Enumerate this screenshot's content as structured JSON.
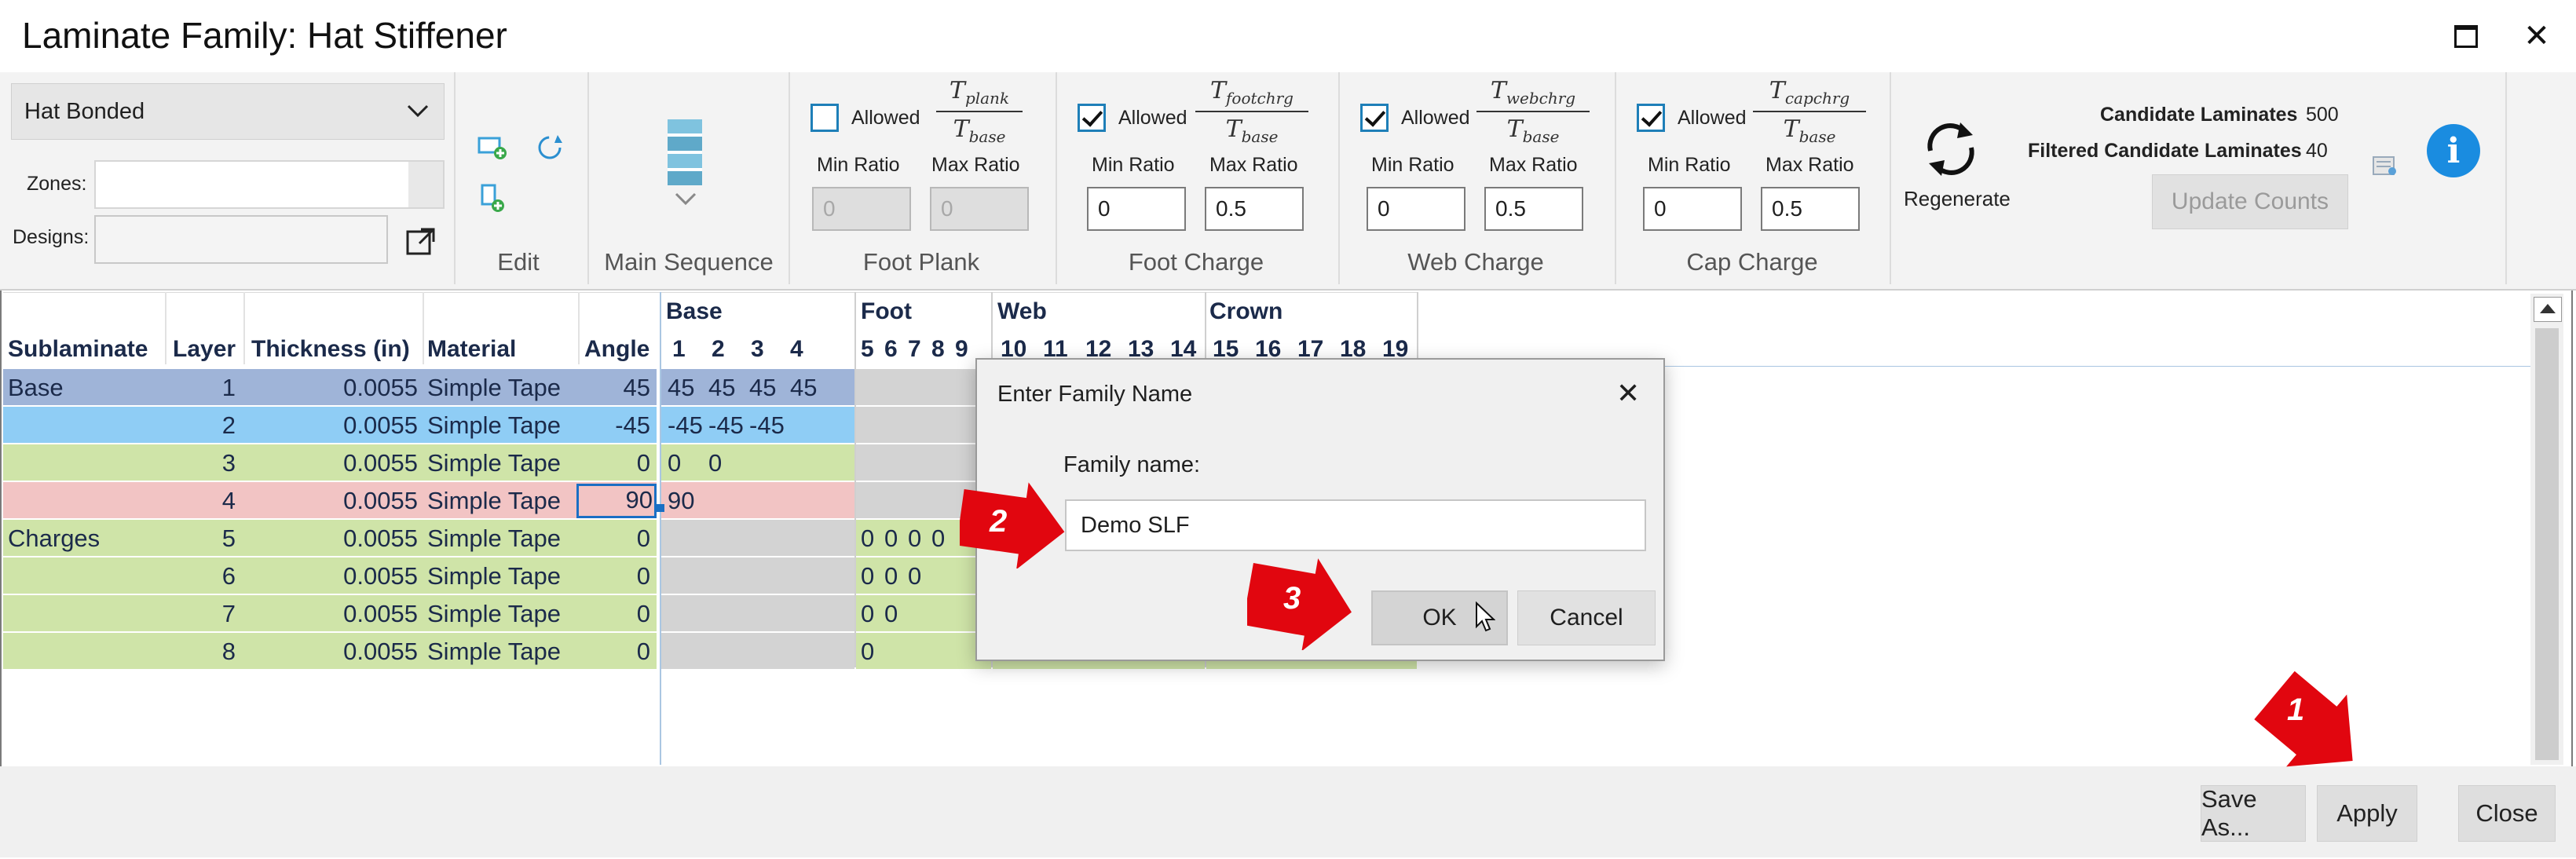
{
  "window": {
    "title": "Laminate Family: Hat Stiffener",
    "maximize_icon": "maximize-icon",
    "close_icon": "close-icon"
  },
  "ribbon": {
    "family_type": "Hat Bonded",
    "zones_label": "Zones:",
    "zones_value": "",
    "designs_label": "Designs:",
    "designs_value": "",
    "edit_label": "Edit",
    "main_sequence_label": "Main Sequence",
    "groups": [
      {
        "label": "Foot Plank",
        "allowed": false,
        "allowed_label": "Allowed",
        "ratio_num": "T_plank",
        "ratio_den": "T_base",
        "min_label": "Min Ratio",
        "max_label": "Max Ratio",
        "min_value": "0",
        "max_value": "0",
        "disabled": true
      },
      {
        "label": "Foot Charge",
        "allowed": true,
        "allowed_label": "Allowed",
        "ratio_num": "T_footchrg",
        "ratio_den": "T_base",
        "min_label": "Min Ratio",
        "max_label": "Max Ratio",
        "min_value": "0",
        "max_value": "0.5",
        "disabled": false
      },
      {
        "label": "Web Charge",
        "allowed": true,
        "allowed_label": "Allowed",
        "ratio_num": "T_webchrg",
        "ratio_den": "T_base",
        "min_label": "Min Ratio",
        "max_label": "Max Ratio",
        "min_value": "0",
        "max_value": "0.5",
        "disabled": false
      },
      {
        "label": "Cap Charge",
        "allowed": true,
        "allowed_label": "Allowed",
        "ratio_num": "T_capchrg",
        "ratio_den": "T_base",
        "min_label": "Min Ratio",
        "max_label": "Max Ratio",
        "min_value": "0",
        "max_value": "0.5",
        "disabled": false
      }
    ],
    "regenerate_label": "Regenerate",
    "candidate_label": "Candidate Laminates",
    "candidate_value": "500",
    "filtered_label": "Filtered Candidate Laminates",
    "filtered_value": "40",
    "update_counts_label": "Update Counts",
    "info_icon": "info-icon"
  },
  "grid": {
    "zone_headers": [
      "Base",
      "Foot",
      "Web",
      "Crown"
    ],
    "columns": [
      "Sublaminate",
      "Layer",
      "Thickness (in)",
      "Material",
      "Angle"
    ],
    "ply_numbers": [
      "1",
      "2",
      "3",
      "4",
      "5",
      "6",
      "7",
      "8",
      "9",
      "10",
      "11",
      "12",
      "13",
      "14",
      "15",
      "16",
      "17",
      "18",
      "19"
    ],
    "rows": [
      {
        "sublaminate": "Base",
        "layer": "1",
        "thickness": "0.0055",
        "material": "Simple Tape",
        "angle": "45",
        "base": [
          "45",
          "45",
          "45",
          "45"
        ],
        "foot": []
      },
      {
        "sublaminate": "",
        "layer": "2",
        "thickness": "0.0055",
        "material": "Simple Tape",
        "angle": "-45",
        "base": [
          "-45",
          "-45",
          "-45"
        ],
        "foot": []
      },
      {
        "sublaminate": "",
        "layer": "3",
        "thickness": "0.0055",
        "material": "Simple Tape",
        "angle": "0",
        "base": [
          "0",
          "0"
        ],
        "foot": []
      },
      {
        "sublaminate": "",
        "layer": "4",
        "thickness": "0.0055",
        "material": "Simple Tape",
        "angle": "90",
        "base": [
          "90"
        ],
        "foot": []
      },
      {
        "sublaminate": "Charges",
        "layer": "5",
        "thickness": "0.0055",
        "material": "Simple Tape",
        "angle": "0",
        "base": [],
        "foot": [
          "0",
          "0",
          "0",
          "0"
        ]
      },
      {
        "sublaminate": "",
        "layer": "6",
        "thickness": "0.0055",
        "material": "Simple Tape",
        "angle": "0",
        "base": [],
        "foot": [
          "0",
          "0",
          "0"
        ]
      },
      {
        "sublaminate": "",
        "layer": "7",
        "thickness": "0.0055",
        "material": "Simple Tape",
        "angle": "0",
        "base": [],
        "foot": [
          "0",
          "0"
        ]
      },
      {
        "sublaminate": "",
        "layer": "8",
        "thickness": "0.0055",
        "material": "Simple Tape",
        "angle": "0",
        "base": [],
        "foot": [
          "0"
        ]
      }
    ]
  },
  "footer": {
    "save_as_label": "Save As...",
    "apply_label": "Apply",
    "close_label": "Close"
  },
  "dialog": {
    "title": "Enter Family Name",
    "field_label": "Family name:",
    "field_value": "Demo SLF",
    "ok_label": "OK",
    "cancel_label": "Cancel"
  },
  "callouts": [
    "1",
    "2",
    "3"
  ],
  "colors": {
    "base_row1": "#9fb4d8",
    "base_row2": "#8fcdf5",
    "base_row3": "#cfe4a8",
    "base_row4": "#f2c4c4",
    "charges": "#cfe4a8",
    "accent": "#1e7fb8",
    "callout": "#e1060f"
  }
}
